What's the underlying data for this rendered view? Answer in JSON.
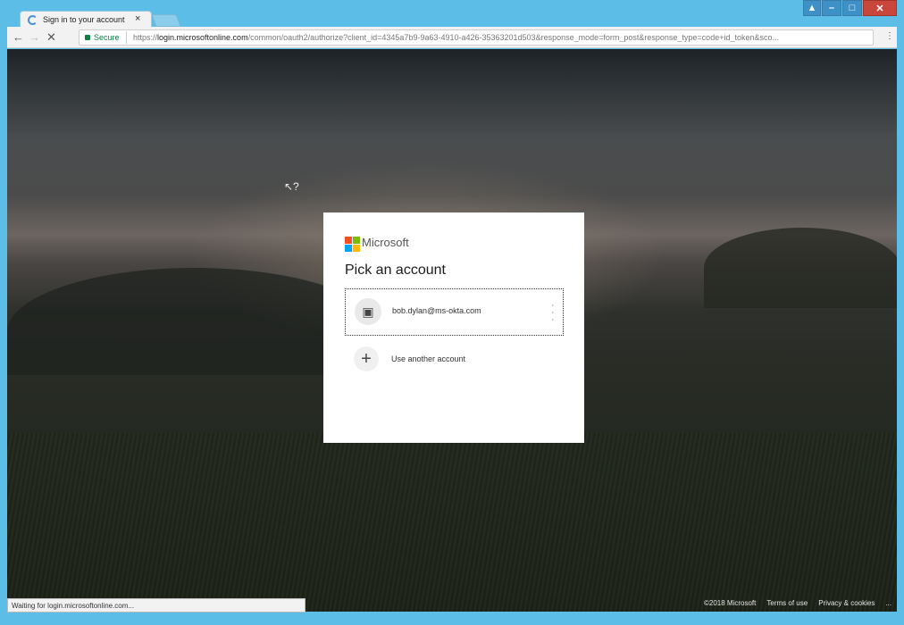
{
  "browser": {
    "tab_title": "Sign in to your account",
    "secure_label": "Secure",
    "url_scheme": "https://",
    "url_host": "login.microsoftonline.com",
    "url_path": "/common/oauth2/authorize?client_id=4345a7b9-9a63-4910-a426-35363201d503&response_mode=form_post&response_type=code+id_token&sco...",
    "status_text": "Waiting for login.microsoftonline.com..."
  },
  "card": {
    "brand": "Microsoft",
    "heading": "Pick an account",
    "account_email": "bob.dylan@ms-okta.com",
    "another_label": "Use another account"
  },
  "footer": {
    "copyright": "©2018 Microsoft",
    "terms": "Terms of use",
    "privacy": "Privacy & cookies",
    "more": "..."
  },
  "colors": {
    "chrome": "#5cbde7",
    "ms_red": "#f25022",
    "ms_green": "#7fba00",
    "ms_blue": "#00a4ef",
    "ms_yellow": "#ffb900"
  }
}
